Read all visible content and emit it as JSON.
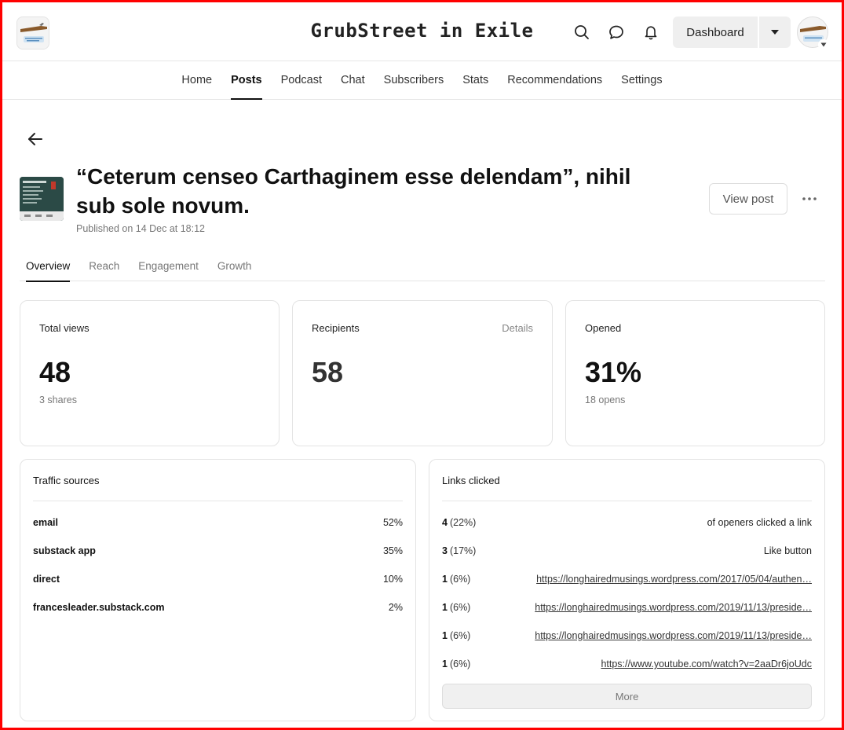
{
  "header": {
    "publication_title": "GrubStreet in Exile",
    "dashboard_label": "Dashboard",
    "icons": [
      "search-icon",
      "chat-icon",
      "bell-icon",
      "caret-down-icon"
    ]
  },
  "nav": {
    "items": [
      {
        "label": "Home"
      },
      {
        "label": "Posts",
        "active": true
      },
      {
        "label": "Podcast"
      },
      {
        "label": "Chat"
      },
      {
        "label": "Subscribers"
      },
      {
        "label": "Stats"
      },
      {
        "label": "Recommendations"
      },
      {
        "label": "Settings"
      }
    ]
  },
  "post": {
    "title": "“Ceterum censeo Carthaginem esse delendam”, nihil sub sole novum.",
    "published": "Published on 14 Dec at 18:12",
    "view_post_label": "View post"
  },
  "tabs": [
    {
      "label": "Overview",
      "active": true
    },
    {
      "label": "Reach"
    },
    {
      "label": "Engagement"
    },
    {
      "label": "Growth"
    }
  ],
  "stats": {
    "total_views": {
      "label": "Total views",
      "value": "48",
      "sub": "3 shares"
    },
    "recipients": {
      "label": "Recipients",
      "value": "58",
      "details_label": "Details"
    },
    "opened": {
      "label": "Opened",
      "value": "31%",
      "sub": "18 opens"
    }
  },
  "traffic": {
    "title": "Traffic sources",
    "rows": [
      {
        "source": "email",
        "pct": "52%"
      },
      {
        "source": "substack app",
        "pct": "35%"
      },
      {
        "source": "direct",
        "pct": "10%"
      },
      {
        "source": "francesleader.substack.com",
        "pct": "2%"
      }
    ]
  },
  "links": {
    "title": "Links clicked",
    "rows": [
      {
        "count": "4",
        "pct": "(22%)",
        "label": "of openers clicked a link",
        "is_link": false
      },
      {
        "count": "3",
        "pct": "(17%)",
        "label": "Like button",
        "is_link": false
      },
      {
        "count": "1",
        "pct": "(6%)",
        "label": "https://longhairedmusings.wordpress.com/2017/05/04/authen…",
        "is_link": true
      },
      {
        "count": "1",
        "pct": "(6%)",
        "label": "https://longhairedmusings.wordpress.com/2019/11/13/preside…",
        "is_link": true
      },
      {
        "count": "1",
        "pct": "(6%)",
        "label": "https://longhairedmusings.wordpress.com/2019/11/13/preside…",
        "is_link": true
      },
      {
        "count": "1",
        "pct": "(6%)",
        "label": "https://www.youtube.com/watch?v=2aaDr6joUdc",
        "is_link": true
      }
    ],
    "more_label": "More"
  }
}
